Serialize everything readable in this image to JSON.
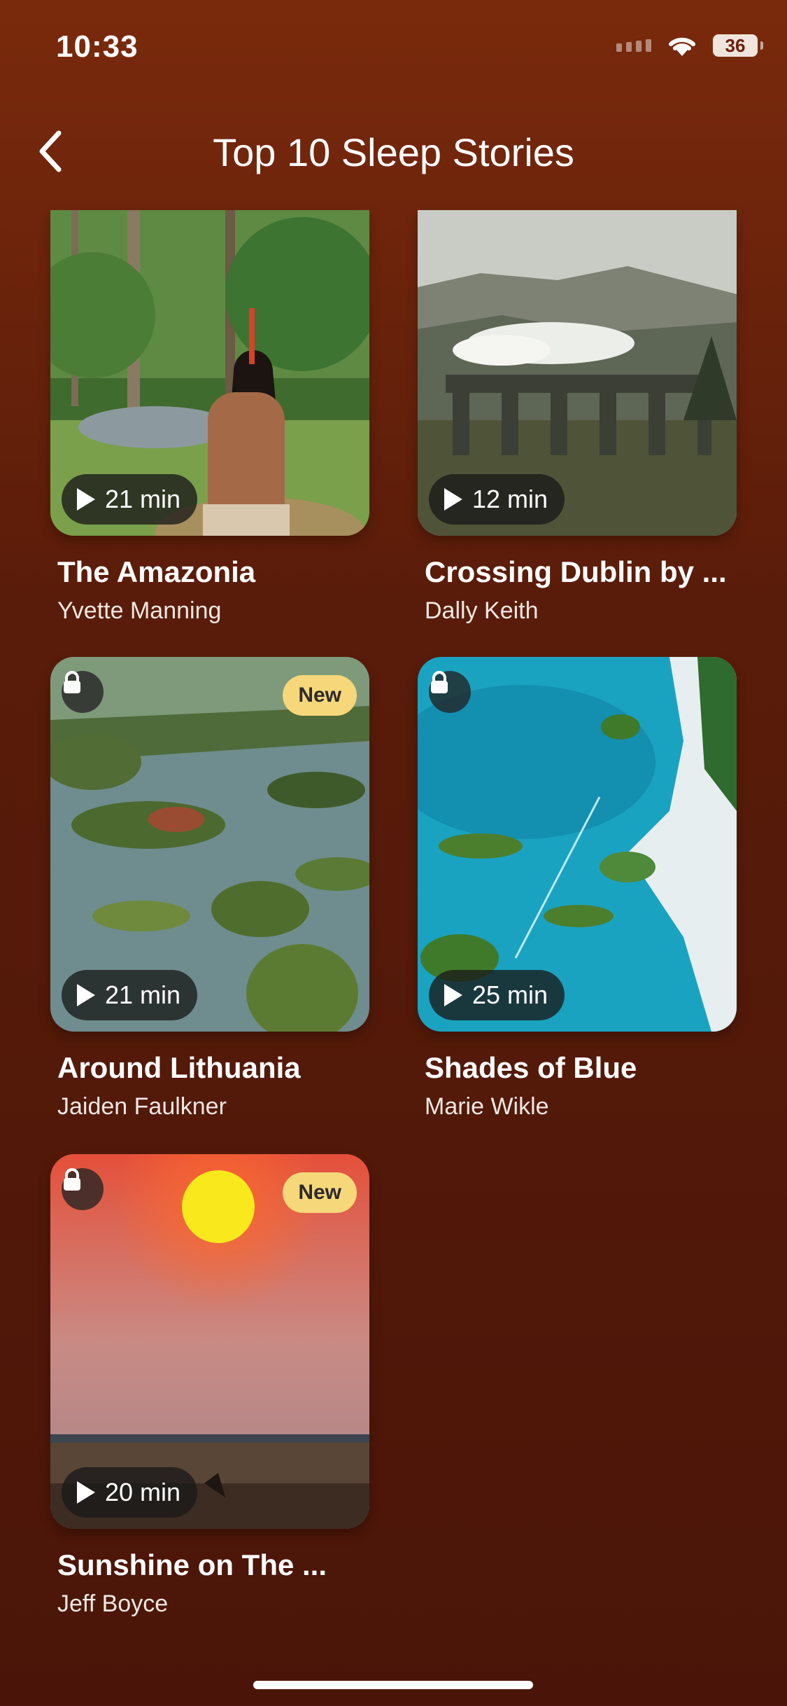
{
  "status": {
    "time": "10:33",
    "battery": "36"
  },
  "header": {
    "title": "Top 10 Sleep Stories"
  },
  "stories": [
    {
      "title": "The Amazonia",
      "author": "Yvette Manning",
      "duration": "21 min"
    },
    {
      "title": "Crossing Dublin by ...",
      "author": "Dally Keith",
      "duration": "12 min"
    },
    {
      "title": "Around Lithuania",
      "author": "Jaiden Faulkner",
      "duration": "21 min",
      "badge": "New"
    },
    {
      "title": "Shades of Blue",
      "author": "Marie Wikle",
      "duration": "25 min"
    },
    {
      "title": "Sunshine on The ...",
      "author": "Jeff Boyce",
      "duration": "20 min",
      "badge": "New"
    }
  ]
}
